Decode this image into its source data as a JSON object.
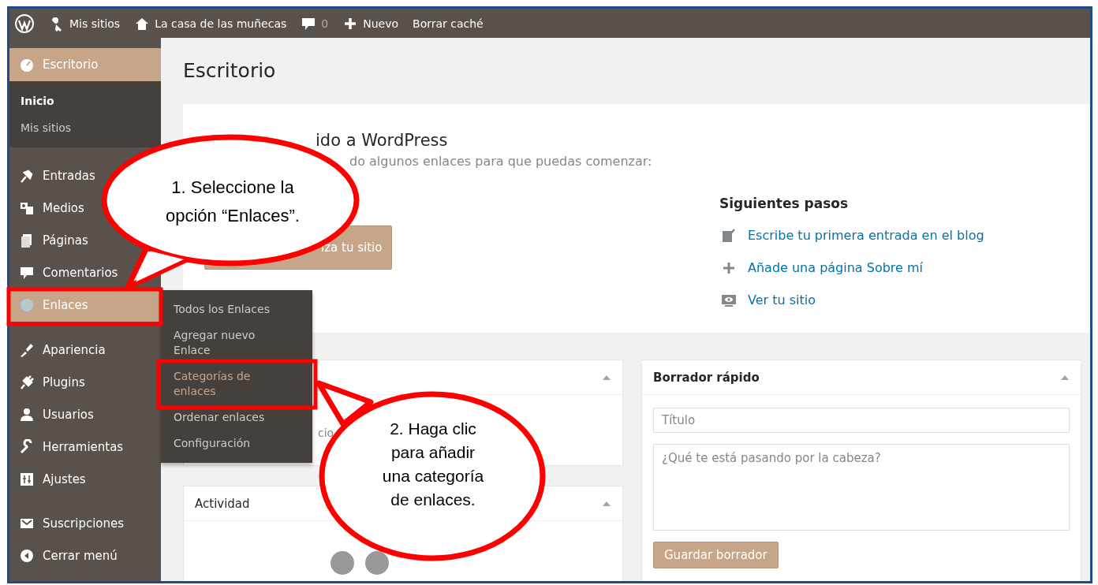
{
  "admin_bar": {
    "items": [
      {
        "label": "Mis sitios"
      },
      {
        "label": "La casa de las muñecas"
      },
      {
        "label": "0"
      },
      {
        "label": "Nuevo"
      },
      {
        "label": "Borrar caché"
      }
    ]
  },
  "sidebar": {
    "items": [
      {
        "label": "Escritorio",
        "selected": true,
        "open": false,
        "section_break": false,
        "children": [
          {
            "label": "Inicio",
            "selected": true
          },
          {
            "label": "Mis sitios",
            "selected": false
          }
        ]
      },
      {
        "label": "Entradas",
        "selected": false,
        "open": false,
        "section_break": true
      },
      {
        "label": "Medios",
        "selected": false,
        "open": false,
        "section_break": false
      },
      {
        "label": "Páginas",
        "selected": false,
        "open": false,
        "section_break": false
      },
      {
        "label": "Comentarios",
        "selected": false,
        "open": false,
        "section_break": false
      },
      {
        "label": "Enlaces",
        "selected": false,
        "open": true,
        "section_break": false,
        "children": [
          {
            "label": "Todos los Enlaces",
            "selected": false
          },
          {
            "label": "Agregar nuevo Enlace",
            "selected": false
          },
          {
            "label": "Categorías de enlaces",
            "selected": true
          },
          {
            "label": "Ordenar enlaces",
            "selected": false
          },
          {
            "label": "Configuración",
            "selected": false
          }
        ]
      },
      {
        "label": "Apariencia",
        "selected": false,
        "open": false,
        "section_break": true
      },
      {
        "label": "Plugins",
        "selected": false,
        "open": false,
        "section_break": false
      },
      {
        "label": "Usuarios",
        "selected": false,
        "open": false,
        "section_break": false
      },
      {
        "label": "Herramientas",
        "selected": false,
        "open": false,
        "section_break": false
      },
      {
        "label": "Ajustes",
        "selected": false,
        "open": false,
        "section_break": false
      },
      {
        "label": "Suscripciones",
        "selected": false,
        "open": false,
        "section_break": true
      },
      {
        "label": "Cerrar menú",
        "selected": false,
        "open": false,
        "section_break": false
      }
    ]
  },
  "page_title": "Escritorio",
  "welcome": {
    "heading": "ido a WordPress",
    "subtitle": "do algunos enlaces para que puedas comenzar:",
    "button": "iza tu sitio",
    "next_steps": {
      "title": "Siguientes pasos",
      "links": [
        {
          "label": "Escribe tu primera entrada en el blog"
        },
        {
          "label": "Añade una página Sobre mí"
        },
        {
          "label": "Ver tu sitio"
        }
      ]
    }
  },
  "widgets": {
    "left": [
      {
        "body": "cio"
      },
      {
        "title": "Actividad"
      }
    ],
    "quick_draft": {
      "title": "Borrador rápido",
      "title_field": {
        "placeholder": "Título"
      },
      "content_field": {
        "placeholder": "¿Qué te está pasando por la cabeza?"
      },
      "button": "Guardar borrador"
    }
  },
  "callouts": [
    {
      "text": "1. Seleccione la opción “Enlaces”."
    },
    {
      "text": "2. Haga clic para añadir una categoría de enlaces."
    }
  ]
}
